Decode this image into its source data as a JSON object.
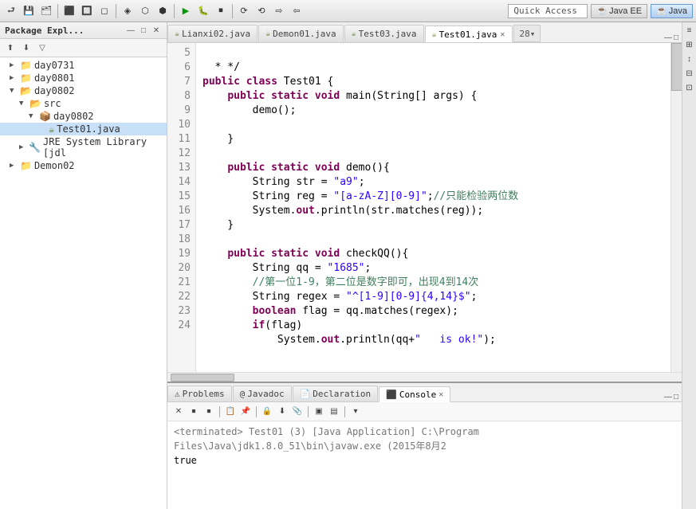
{
  "toolbar": {
    "quick_access_placeholder": "Quick Access",
    "perspective_java_ee": "Java EE",
    "perspective_java": "Java"
  },
  "sidebar": {
    "title": "Package Expl...",
    "tree": [
      {
        "id": "day0731",
        "label": "day0731",
        "indent": "tree-indent-1",
        "type": "folder",
        "expanded": false
      },
      {
        "id": "day0801",
        "label": "day0801",
        "indent": "tree-indent-1",
        "type": "folder",
        "expanded": false
      },
      {
        "id": "day0802",
        "label": "day0802",
        "indent": "tree-indent-1",
        "type": "folder",
        "expanded": true
      },
      {
        "id": "src",
        "label": "src",
        "indent": "tree-indent-2",
        "type": "src",
        "expanded": true
      },
      {
        "id": "day0802pkg",
        "label": "day0802",
        "indent": "tree-indent-3",
        "type": "package",
        "expanded": true
      },
      {
        "id": "Test01java",
        "label": "Test01.java",
        "indent": "tree-indent-4",
        "type": "java",
        "expanded": false,
        "selected": true
      },
      {
        "id": "JRE",
        "label": "JRE System Library [jdl",
        "indent": "tree-indent-2",
        "type": "lib",
        "expanded": false
      },
      {
        "id": "Demon02",
        "label": "Demon02",
        "indent": "tree-indent-1",
        "type": "folder",
        "expanded": false
      }
    ]
  },
  "editor": {
    "tabs": [
      {
        "id": "lianxi02",
        "label": "Lianxi02.java",
        "active": false,
        "modified": false
      },
      {
        "id": "demon01",
        "label": "Demon01.java",
        "active": false,
        "modified": false
      },
      {
        "id": "test03",
        "label": "Test03.java",
        "active": false,
        "modified": false
      },
      {
        "id": "test01",
        "label": "Test01.java",
        "active": true,
        "modified": false
      }
    ],
    "overflow_count": "28",
    "lines": [
      {
        "num": 5,
        "content": "  * */"
      },
      {
        "num": 6,
        "content": "public class Test01 {"
      },
      {
        "num": 7,
        "content": "    public static void main(String[] args) {"
      },
      {
        "num": 8,
        "content": "        demo();"
      },
      {
        "num": 9,
        "content": ""
      },
      {
        "num": 10,
        "content": "    }"
      },
      {
        "num": 11,
        "content": ""
      },
      {
        "num": 12,
        "content": "    public static void demo(){"
      },
      {
        "num": 13,
        "content": "        String str = \"a9\";"
      },
      {
        "num": 14,
        "content": "        String reg = \"[a-zA-Z][0-9]\";//只能检验两位数"
      },
      {
        "num": 15,
        "content": "        System.out.println(str.matches(reg));"
      },
      {
        "num": 16,
        "content": "    }"
      },
      {
        "num": 17,
        "content": ""
      },
      {
        "num": 18,
        "content": "    public static void checkQQ(){"
      },
      {
        "num": 19,
        "content": "        String qq = \"1685\";"
      },
      {
        "num": 20,
        "content": "        //第一位1-9，第二位是数字即可，出现4到14次"
      },
      {
        "num": 21,
        "content": "        String regex = \"^[1-9][0-9]{4,14}$\";"
      },
      {
        "num": 22,
        "content": "        boolean flag = qq.matches(regex);"
      },
      {
        "num": 23,
        "content": "        if(flag)"
      },
      {
        "num": 24,
        "content": "            System.out.println(qq+\"   is ok!\");"
      }
    ]
  },
  "bottom_panel": {
    "tabs": [
      {
        "id": "problems",
        "label": "Problems",
        "active": false
      },
      {
        "id": "javadoc",
        "label": "Javadoc",
        "active": false
      },
      {
        "id": "declaration",
        "label": "Declaration",
        "active": false
      },
      {
        "id": "console",
        "label": "Console",
        "active": true
      }
    ],
    "console": {
      "terminated_line": "<terminated> Test01 (3) [Java Application] C:\\Program Files\\Java\\jdk1.8.0_51\\bin\\javaw.exe (2015年8月2",
      "output_line": "true"
    }
  }
}
